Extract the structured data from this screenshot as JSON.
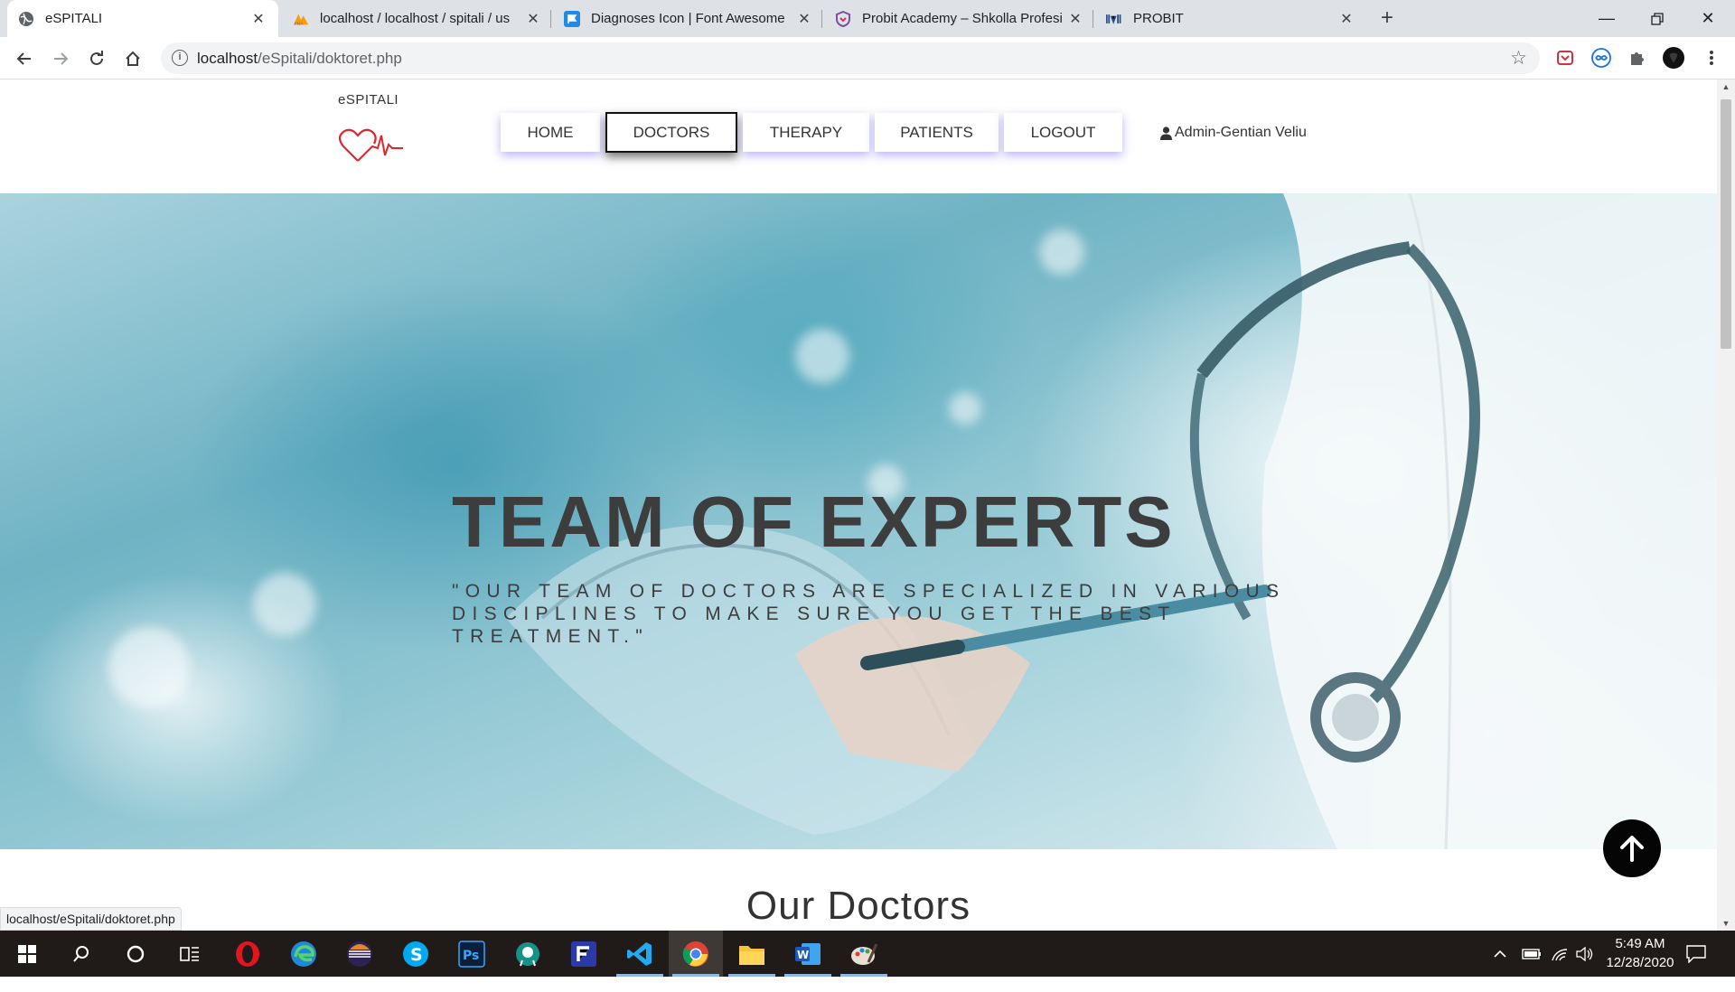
{
  "browser": {
    "tabs": [
      {
        "title": "eSPITALI",
        "icon": "globe-icon",
        "active": true
      },
      {
        "title": "localhost / localhost / spitali / us",
        "icon": "phpmyadmin-icon",
        "active": false
      },
      {
        "title": "Diagnoses Icon | Font Awesome",
        "icon": "flag-icon",
        "active": false
      },
      {
        "title": "Probit Academy – Shkolla Profesi",
        "icon": "shield-icon",
        "active": false
      },
      {
        "title": "PROBIT",
        "icon": "probit-logo-icon",
        "active": false
      }
    ],
    "url_host": "localhost",
    "url_path": "/eSpitali/doktoret.php",
    "status_url": "localhost/eSpitali/doktoret.php"
  },
  "site": {
    "brand": "eSPITALI",
    "nav": [
      {
        "label": "HOME",
        "active": false
      },
      {
        "label": "DOCTORS",
        "active": true
      },
      {
        "label": "THERAPY",
        "active": false
      },
      {
        "label": "PATIENTS",
        "active": false
      },
      {
        "label": "LOGOUT",
        "active": false
      }
    ],
    "user": "Admin-Gentian Veliu",
    "hero_title": "TEAM OF EXPERTS",
    "hero_subtitle": "\"Our team of doctors are specialized in various disciplines to make sure you get the best treatment.\"",
    "section_title": "Our Doctors"
  },
  "taskbar": {
    "time": "5:49 AM",
    "date": "12/28/2020"
  },
  "colors": {
    "accent_shadow": "#645ae6",
    "text": "#333333",
    "hero_text": "#3d3d3d",
    "to_top_button": "#050505",
    "taskbar": "#201b18"
  }
}
